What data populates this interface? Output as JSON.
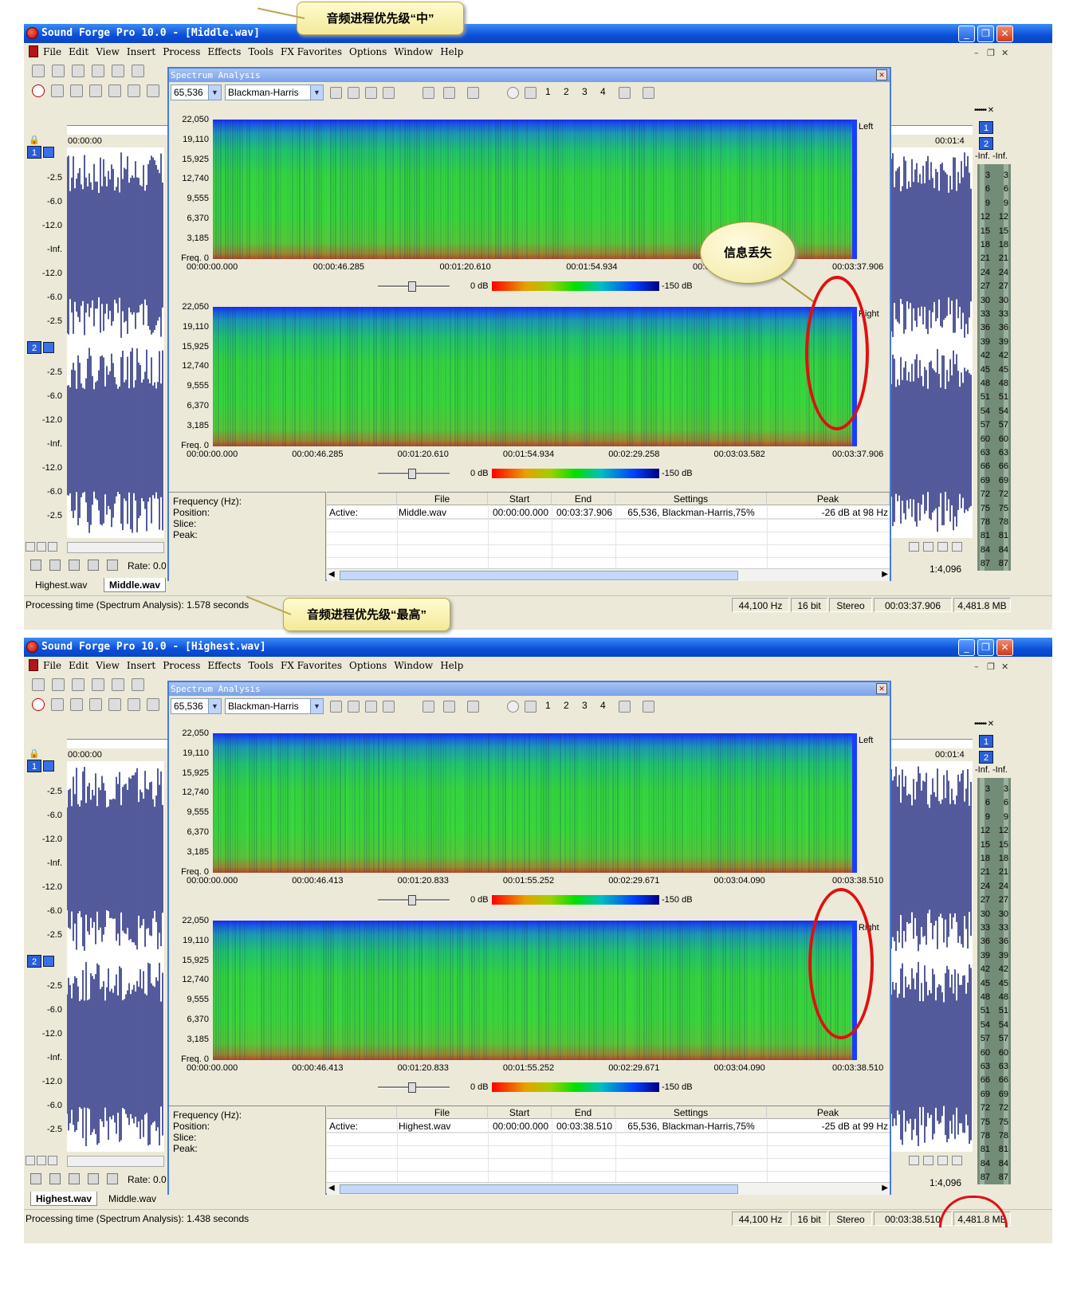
{
  "screens": [
    {
      "window_title": "Sound Forge Pro 10.0 - [Middle.wav]",
      "callout": "音频进程优先级“中”",
      "tabs": [
        "Highest.wav",
        "Middle.wav"
      ],
      "active_tab": 1,
      "freq_ticks": [
        "22,050",
        "19,110",
        "15,925",
        "12,740",
        "9,555",
        "6,370",
        "3,185",
        "Freq. 0"
      ],
      "time_ticks_top": [
        "00:00:00.000",
        "00:00:46.285",
        "00:01:20.610",
        "00:01:54.934",
        "00:02:29.258",
        "00:03:37.906"
      ],
      "time_ticks_bottom": [
        "00:00:00.000",
        "00:00:46.285",
        "00:01:20.610",
        "00:01:54.934",
        "00:02:29.258",
        "00:03:03.582",
        "00:03:37.906"
      ],
      "table_row": {
        "active": "Active:",
        "file": "Middle.wav",
        "start": "00:00:00.000",
        "end": "00:03:37.906",
        "settings": "65,536, Blackman-Harris,75%",
        "peak": "-26 dB at 98 Hz"
      },
      "status_text": "Processing time (Spectrum Analysis): 1.578 seconds",
      "status_length": "00:03:37.906",
      "bubble": "信息丢失",
      "ring_style": "middle"
    },
    {
      "window_title": "Sound Forge Pro 10.0 - [Highest.wav]",
      "callout": "音频进程优先级“最高”",
      "tabs": [
        "Highest.wav",
        "Middle.wav"
      ],
      "active_tab": 0,
      "freq_ticks": [
        "22,050",
        "19,110",
        "15,925",
        "12,740",
        "9,555",
        "6,370",
        "3,185",
        "Freq. 0"
      ],
      "time_ticks_top": [
        "00:00:00.000",
        "00:00:46.413",
        "00:01:20.833",
        "00:01:55.252",
        "00:02:29.671",
        "00:03:04.090",
        "00:03:38.510"
      ],
      "time_ticks_bottom": [
        "00:00:00.000",
        "00:00:46.413",
        "00:01:20.833",
        "00:01:55.252",
        "00:02:29.671",
        "00:03:04.090",
        "00:03:38.510"
      ],
      "table_row": {
        "active": "Active:",
        "file": "Highest.wav",
        "start": "00:00:00.000",
        "end": "00:03:38.510",
        "settings": "65,536, Blackman-Harris,75%",
        "peak": "-25 dB at 99 Hz"
      },
      "status_text": "Processing time (Spectrum Analysis): 1.438 seconds",
      "status_length": "00:03:38.510",
      "bubble": "",
      "ring_style": "highest"
    }
  ],
  "menu": [
    "File",
    "Edit",
    "View",
    "Insert",
    "Process",
    "Effects",
    "Tools",
    "FX Favorites",
    "Options",
    "Window",
    "Help"
  ],
  "spectrum_title": "Spectrum Analysis",
  "fft_size": "65,536",
  "window_fn": "Blackman-Harris",
  "view_numbers": [
    "1",
    "2",
    "3",
    "4"
  ],
  "channel_left": "Left",
  "channel_right": "Right",
  "legend_low": "0 dB",
  "legend_high": "-150 dB",
  "info_labels": [
    "Frequency (Hz):",
    "Position:",
    "Slice:",
    "Peak:"
  ],
  "table_headers": [
    "File",
    "Start",
    "End",
    "Settings",
    "Peak"
  ],
  "db_labels": [
    "-2.5",
    "-6.0",
    "-12.0",
    "-Inf.",
    "-12.0",
    "-6.0",
    "-2.5"
  ],
  "channel_numbers": [
    "1",
    "2"
  ],
  "timeline_start": "00:00:00",
  "timeline_end": "00:01:4",
  "rate_label": "Rate: 0.0",
  "zoom": "1:4,096",
  "meter_header": "-Inf. -Inf.",
  "meter_ticks": [
    "3",
    "6",
    "9",
    "12",
    "15",
    "18",
    "21",
    "24",
    "27",
    "30",
    "33",
    "36",
    "39",
    "42",
    "45",
    "48",
    "51",
    "54",
    "57",
    "60",
    "63",
    "66",
    "69",
    "72",
    "75",
    "78",
    "81",
    "84",
    "87"
  ],
  "status_cells": [
    "44,100 Hz",
    "16 bit",
    "Stereo",
    "4,481.8 MB"
  ],
  "colors": {
    "titlebar": "#0a4fd8",
    "waveform": "#0a1470",
    "ring": "#e01010",
    "meter": "#738c78"
  }
}
